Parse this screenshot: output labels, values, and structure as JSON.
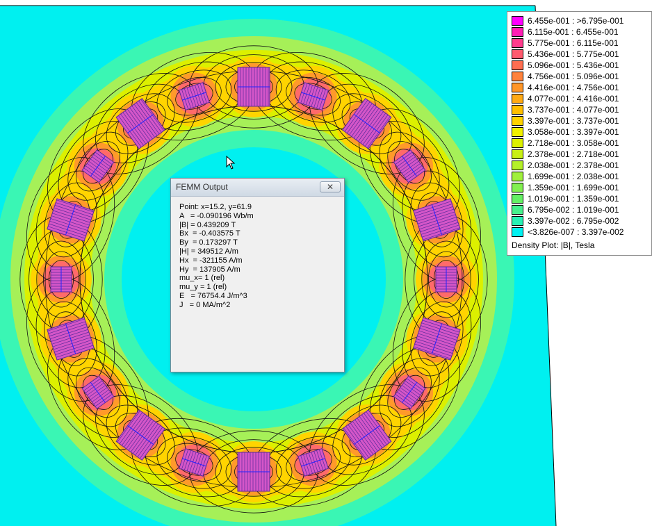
{
  "colors": {
    "background": "#00f0f0",
    "band_1": "#3af6b4",
    "band_2": "#a6f058",
    "band_3": "#dcf000",
    "band_4": "#ffd400",
    "band_5": "#ff9a2a",
    "band_6": "#ff6a6a",
    "coil": "#d456c8",
    "coil_lines": "#5a2a9a",
    "contour": "#111111"
  },
  "legend": {
    "rows": [
      {
        "label": "6.455e-001 : >6.795e-001",
        "color": "#ff00ff"
      },
      {
        "label": "6.115e-001 : 6.455e-001",
        "color": "#ff1eb4"
      },
      {
        "label": "5.775e-001 : 6.115e-001",
        "color": "#ff3c8c"
      },
      {
        "label": "5.436e-001 : 5.775e-001",
        "color": "#ff5a6e"
      },
      {
        "label": "5.096e-001 : 5.436e-001",
        "color": "#ff6e50"
      },
      {
        "label": "4.756e-001 : 5.096e-001",
        "color": "#ff823c"
      },
      {
        "label": "4.416e-001 : 4.756e-001",
        "color": "#ff9628"
      },
      {
        "label": "4.077e-001 : 4.416e-001",
        "color": "#ffaa14"
      },
      {
        "label": "3.737e-001 : 4.077e-001",
        "color": "#ffbe00"
      },
      {
        "label": "3.397e-001 : 3.737e-001",
        "color": "#ffd200"
      },
      {
        "label": "3.058e-001 : 3.397e-001",
        "color": "#f0f000"
      },
      {
        "label": "2.718e-001 : 3.058e-001",
        "color": "#dcf000"
      },
      {
        "label": "2.378e-001 : 2.718e-001",
        "color": "#c8f014"
      },
      {
        "label": "2.038e-001 : 2.378e-001",
        "color": "#b4f028"
      },
      {
        "label": "1.699e-001 : 2.038e-001",
        "color": "#a0f03c"
      },
      {
        "label": "1.359e-001 : 1.699e-001",
        "color": "#82f050"
      },
      {
        "label": "1.019e-001 : 1.359e-001",
        "color": "#64f064"
      },
      {
        "label": "6.795e-002 : 1.019e-001",
        "color": "#46f08c"
      },
      {
        "label": "3.397e-002 : 6.795e-002",
        "color": "#28f0b4"
      },
      {
        "label": "<3.826e-007 : 3.397e-002",
        "color": "#00f0f0"
      }
    ],
    "title": "Density Plot: |B|, Tesla"
  },
  "dialog": {
    "title": "FEMM Output",
    "close_glyph": "✕",
    "lines": [
      "Point: x=15.2, y=61.9",
      "A   = -0.090196 Wb/m",
      "|B| = 0.439209 T",
      "Bx  = -0.403575 T",
      "By  = 0.173297 T",
      "|H| = 349512 A/m",
      "Hx  = -321155 A/m",
      "Hy  = 137905 A/m",
      "mu_x= 1 (rel)",
      "mu_y = 1 (rel)",
      "E   = 76754.4 J/m^3",
      "J   = 0 MA/m^2"
    ]
  },
  "cursor_icon": "mouse-pointer-icon"
}
